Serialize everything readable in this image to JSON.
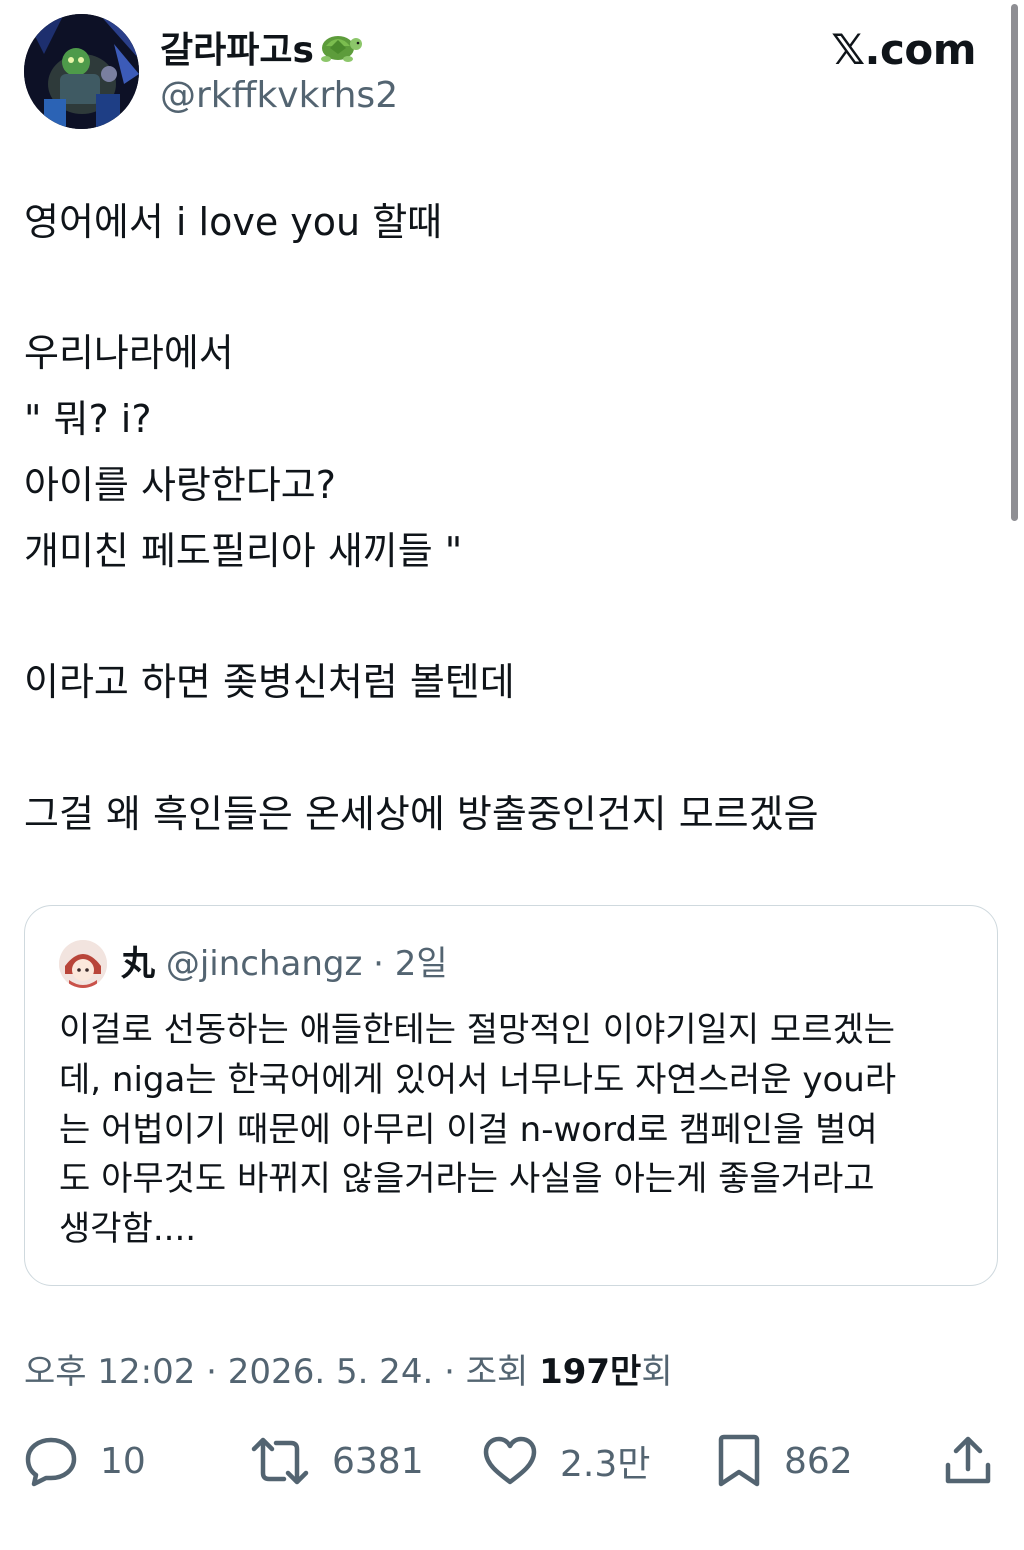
{
  "author": {
    "display_name": "갈라파고s",
    "handle": "@rkffkvkrhs2"
  },
  "brand": "𝕏.com",
  "tweet_lines": [
    "영어에서 i love you 할때",
    "우리나라에서",
    "\" 뭐? i?",
    "아이를 사랑한다고?",
    "개미친 페도필리아 새끼들 \"",
    "이라고 하면 좆병신처럼 볼텐데",
    "그걸 왜 흑인들은 온세상에 방출중인건지 모르겠음"
  ],
  "quote": {
    "name": "丸",
    "handle": "@jinchangz",
    "separator": " · ",
    "time": "2일",
    "lines": [
      "이걸로 선동하는 애들한테는 절망적인 이야기일지 모르겠는",
      "데, niga는 한국어에게 있어서 너무나도 자연스러운 you라",
      "는 어법이기 때문에 아무리 이걸 n-word로 캠페인을 벌여",
      "도 아무것도 바뀌지 않을거라는 사실을 아는게 좋을거라고",
      "생각함...."
    ]
  },
  "meta": {
    "time": "오후 12:02",
    "sep1": " · ",
    "date": "2026. 5. 24.",
    "sep2": " · ",
    "views_label": "조회 ",
    "views_count": "197만",
    "views_suffix": "회"
  },
  "actions": {
    "replies": "10",
    "retweets": "6381",
    "likes": "2.3만",
    "bookmarks": "862"
  },
  "icons": [
    "reply-icon",
    "retweet-icon",
    "like-icon",
    "bookmark-icon",
    "share-icon",
    "turtle-emoji-icon"
  ],
  "colors": {
    "text": "#0f1419",
    "secondary": "#536471",
    "border": "#cfd9de",
    "background": "#ffffff"
  }
}
